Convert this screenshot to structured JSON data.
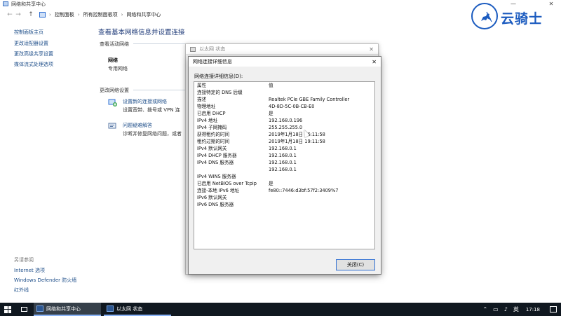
{
  "window": {
    "title": "网络和共享中心",
    "minimize": "—",
    "close": "✕"
  },
  "addressbar": {
    "back": "←",
    "forward": "→",
    "up": "↑",
    "crumbs": [
      "控制面板",
      "所有控制面板项",
      "网络和共享中心"
    ],
    "separator": "›"
  },
  "sidebar": {
    "links": [
      "控制面板主页",
      "更改适配器设置",
      "更改高级共享设置",
      "媒体流式处理选项"
    ],
    "see_also_label": "另请参阅",
    "bottom_links": [
      "Internet 选项",
      "Windows Defender 防火墙",
      "红外线"
    ]
  },
  "main": {
    "title": "查看基本网络信息并设置连接",
    "active_networks_label": "查看活动网络",
    "network_name": "网络",
    "network_type": "专用网络",
    "change_settings_label": "更改网络设置",
    "tasks": [
      {
        "title": "设置新的连接或网络",
        "desc": "设置宽带、拨号或 VPN 连"
      },
      {
        "title": "问题疑难解答",
        "desc": "诊断并修复网络问题，或者"
      }
    ]
  },
  "eth_status_window": {
    "title": "以太网 状态",
    "close": "✕"
  },
  "details_dialog": {
    "title": "网络连接详细信息",
    "close": "✕",
    "list_label": "网络连接详细信息(D):",
    "columns": {
      "property": "属性",
      "value": "值"
    },
    "rows": [
      {
        "property": "连接特定的 DNS 后缀",
        "value": ""
      },
      {
        "property": "描述",
        "value": "Realtek PCIe GBE Family Controller"
      },
      {
        "property": "物理地址",
        "value": "4D-8D-5C-0B-CB-E0"
      },
      {
        "property": "已启用 DHCP",
        "value": "是"
      },
      {
        "property": "IPv4 地址",
        "value": "192.168.0.196"
      },
      {
        "property": "IPv4 子网掩码",
        "value": "255.255.255.0"
      },
      {
        "property": "获得租约的时间",
        "value": "2019年1月18日 16:11:58"
      },
      {
        "property": "租约过期的时间",
        "value": "2019年1月18日 19:11:58"
      },
      {
        "property": "IPv4 默认网关",
        "value": "192.168.0.1"
      },
      {
        "property": "IPv4 DHCP 服务器",
        "value": "192.168.0.1"
      },
      {
        "property": "IPv4 DNS 服务器",
        "value": "192.168.0.1"
      },
      {
        "property": "",
        "value": "192.168.0.1"
      },
      {
        "property": "IPv4 WINS 服务器",
        "value": ""
      },
      {
        "property": "已启用 NetBIOS over Tcpip",
        "value": "是"
      },
      {
        "property": "连接-本地 IPv6 地址",
        "value": "fe80::7446:d3bf:57f2:3409%7"
      },
      {
        "property": "IPv6 默认网关",
        "value": ""
      },
      {
        "property": "IPv6 DNS 服务器",
        "value": ""
      }
    ],
    "close_button": "关闭(C)"
  },
  "watermark": {
    "text": "云骑士"
  },
  "taskbar": {
    "items": [
      "网络和共享中心",
      "以太网 状态"
    ],
    "ime": "英",
    "clock": "17:18"
  },
  "colors": {
    "link_blue": "#1f4f8a",
    "title_blue": "#1e3a78",
    "taskbar": "#101820",
    "logo_blue": "#1b5bbf"
  }
}
